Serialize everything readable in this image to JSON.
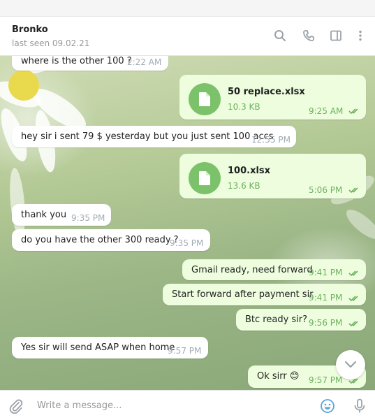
{
  "header": {
    "name": "Bronko",
    "status": "last seen 09.02.21",
    "icons": [
      "search-icon",
      "phone-icon",
      "sidebar-icon",
      "more-icon"
    ]
  },
  "messages": [
    {
      "direction": "in",
      "text": "where is the other 100 ?",
      "time": "2:22 AM"
    },
    {
      "direction": "out",
      "type": "file",
      "file_name": "50 replace.xlsx",
      "file_size": "10.3 KB",
      "time": "9:25 AM",
      "read": true
    },
    {
      "direction": "in",
      "text": "hey sir i sent 79 $ yesterday but you just sent 100 accs",
      "time": "12:55 PM"
    },
    {
      "direction": "out",
      "type": "file",
      "file_name": "100.xlsx",
      "file_size": "13.6 KB",
      "time": "5:06 PM",
      "read": true
    },
    {
      "direction": "in",
      "text": "thank you",
      "time": "9:35 PM"
    },
    {
      "direction": "in",
      "text": "do you have the other 300 ready ?",
      "time": "9:35 PM"
    },
    {
      "direction": "out",
      "text": "Gmail ready, need forward",
      "time": "9:41 PM",
      "read": true
    },
    {
      "direction": "out",
      "text": "Start forward after payment sir",
      "time": "9:41 PM",
      "read": true
    },
    {
      "direction": "out",
      "text": "Btc ready sir?",
      "time": "9:56 PM",
      "read": true
    },
    {
      "direction": "in",
      "text": "Yes sir will send ASAP when home",
      "time": "9:57 PM"
    },
    {
      "direction": "out",
      "text": "Ok sirr",
      "emoji": "😊",
      "time": "9:57 PM",
      "read": true
    }
  ],
  "composer": {
    "placeholder": "Write a message...",
    "icons": [
      "attach-icon",
      "emoji-icon",
      "microphone-icon"
    ]
  },
  "colors": {
    "outgoing_bubble": "#eefdde",
    "incoming_bubble": "#ffffff",
    "accent_green": "#6cb25e",
    "file_icon_bg": "#7cc26a",
    "icon_blue": "#5aa5d8"
  }
}
